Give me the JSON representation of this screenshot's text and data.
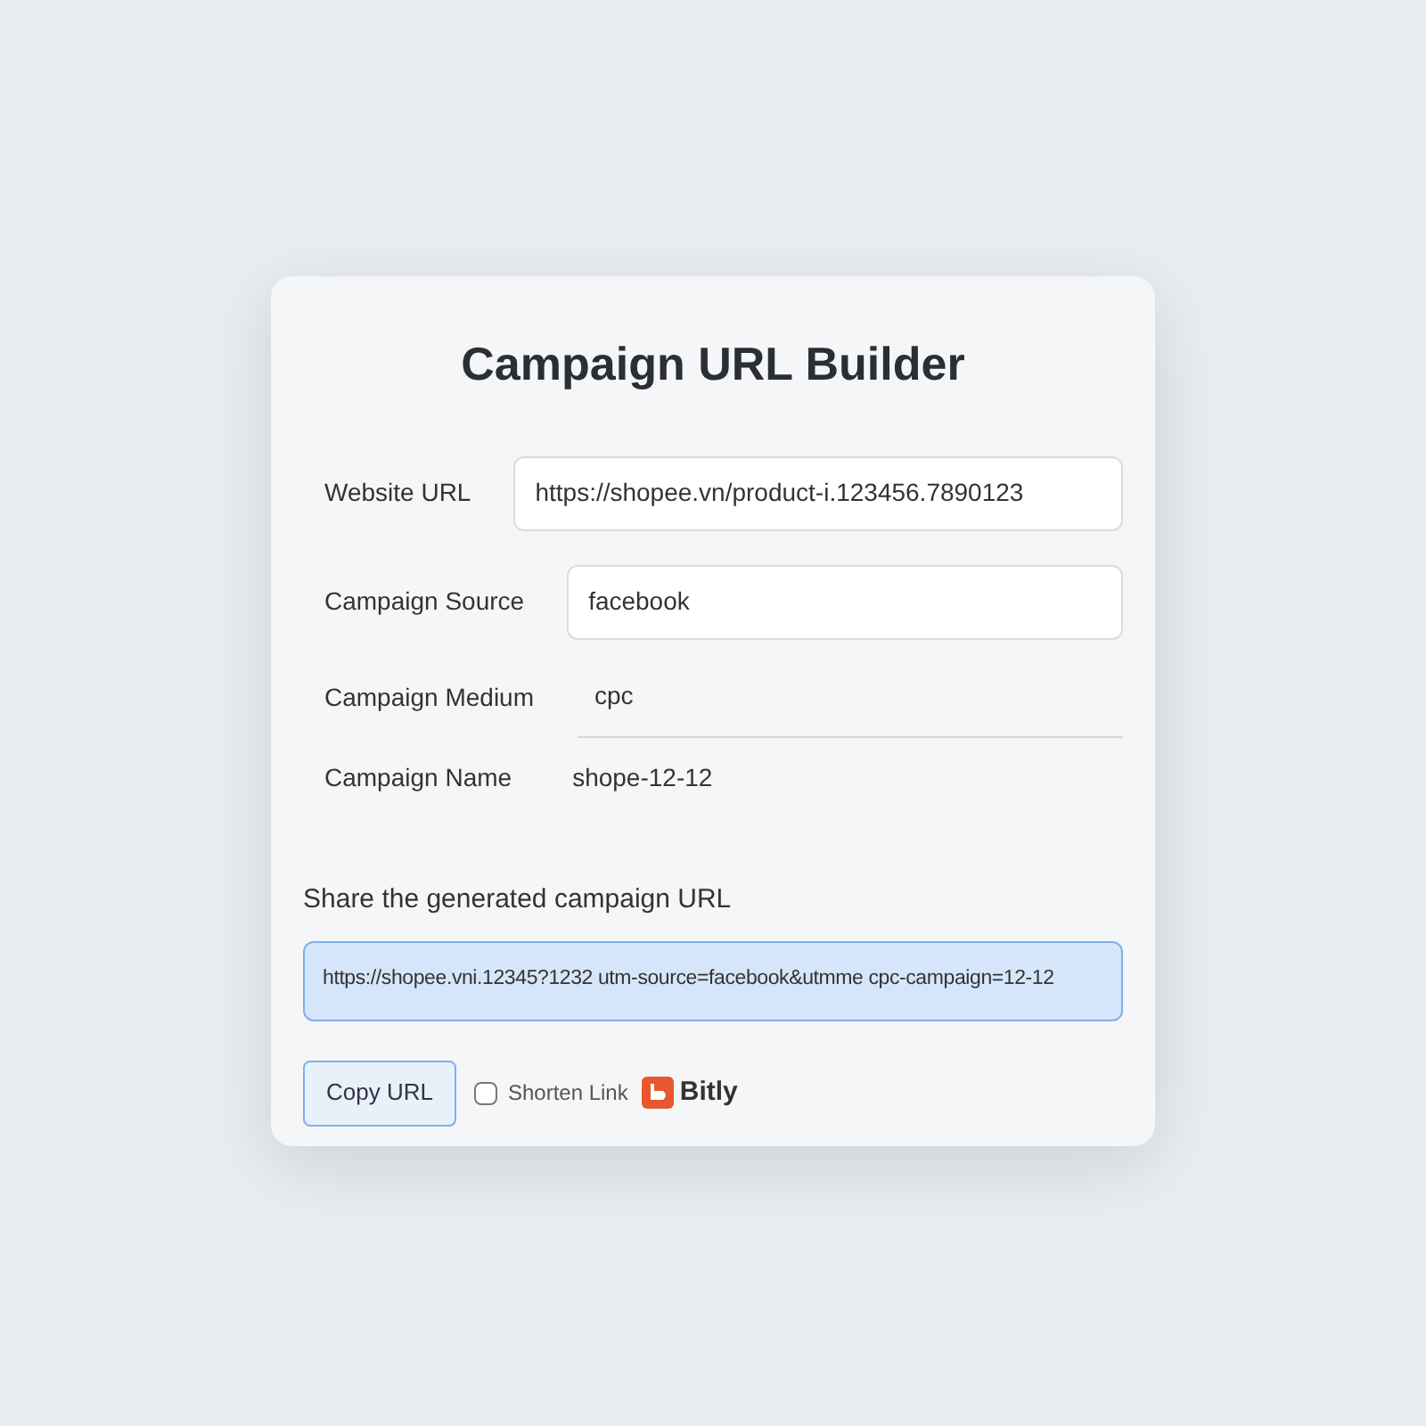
{
  "title": "Campaign URL Builder",
  "fields": [
    {
      "kind": "input",
      "label": "Website URL",
      "value": "https://shopee.vn/product-i.123456.7890123"
    },
    {
      "kind": "input",
      "label": "Campaign Source",
      "value": "facebook"
    },
    {
      "kind": "underline",
      "label": "Campaign Medium",
      "value": "cpc"
    },
    {
      "kind": "plain",
      "label": "Campaign Name",
      "value": "shope-12-12"
    }
  ],
  "share_label": "Share the generated campaign URL",
  "generated_url": "https://shopee.vni.12345?1232 utm-source=facebook&utmme cpc-campaign=12-12",
  "copy_button": "Copy URL",
  "shorten": {
    "label": "Shorten Link",
    "checked": false
  },
  "provider": "Bitly"
}
